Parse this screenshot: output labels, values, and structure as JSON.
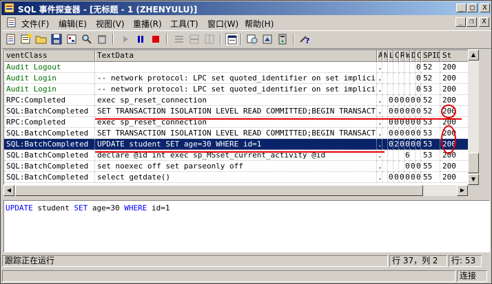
{
  "window": {
    "title": "SQL 事件探查器 - [无标题 - 1 (ZHENYULU)]",
    "buttons": {
      "minimize": "_",
      "maximize": "□",
      "close": "X"
    },
    "mdi_buttons": {
      "minimize": "_",
      "restore": "❐",
      "close": "X"
    }
  },
  "menu": [
    {
      "label": "文件(F)"
    },
    {
      "label": "编辑(E)"
    },
    {
      "label": "视图(V)"
    },
    {
      "label": "重播(R)"
    },
    {
      "label": "工具(T)"
    },
    {
      "label": "窗口(W)"
    },
    {
      "label": "帮助(H)"
    }
  ],
  "grid": {
    "columns": [
      "ventClass",
      "TextData",
      "A",
      "N",
      "L",
      "C",
      "R",
      "W",
      "D",
      "C",
      "SPID",
      "St"
    ],
    "rows": [
      {
        "cells": [
          "Audit Logout",
          "",
          "......",
          "",
          "",
          "",
          "",
          "",
          "",
          "0",
          "52",
          "200"
        ],
        "style": "green"
      },
      {
        "cells": [
          "Audit Login",
          "-- network protocol: LPC set quoted_identifier on set implicit_...",
          "......",
          "",
          "",
          "",
          "",
          "",
          "",
          "0",
          "52",
          "200"
        ],
        "style": "green"
      },
      {
        "cells": [
          "Audit Login",
          "-- network protocol: LPC set quoted_identifier on set implicit_...",
          "......",
          "",
          "",
          "",
          "",
          "",
          "",
          "0",
          "53",
          "200"
        ],
        "style": "green"
      },
      {
        "cells": [
          "RPC:Completed",
          "exec sp_reset_connection",
          "......",
          "",
          "0",
          "0",
          "0",
          "0",
          "0",
          "0",
          "52",
          "200"
        ],
        "style": ""
      },
      {
        "cells": [
          "SQL:BatchCompleted",
          "SET TRANSACTION ISOLATION LEVEL READ COMMITTED;BEGIN TRANSACTION",
          "......",
          "",
          "0",
          "0",
          "0",
          "0",
          "0",
          "0",
          "52",
          "200"
        ],
        "style": ""
      },
      {
        "cells": [
          "RPC:Completed",
          "exec sp_reset_connection",
          "......",
          "",
          "0",
          "0",
          "0",
          "0",
          "0",
          "0",
          "53",
          "200"
        ],
        "style": ""
      },
      {
        "cells": [
          "SQL:BatchCompleted",
          "SET TRANSACTION ISOLATION LEVEL READ COMMITTED;BEGIN TRANSACTION",
          "......",
          "",
          "0",
          "0",
          "0",
          "0",
          "0",
          "0",
          "53",
          "200"
        ],
        "style": ""
      },
      {
        "cells": [
          "SQL:BatchCompleted",
          "UPDATE student SET age=30 WHERE id=1",
          "......",
          "",
          "0",
          "2",
          "0",
          "0",
          "0",
          "0",
          "53",
          "200"
        ],
        "style": "sel"
      },
      {
        "cells": [
          "SQL:BatchCompleted",
          "declare @id int exec sp_MSset_current_activity @id",
          "......",
          "",
          "",
          "",
          "",
          "6",
          "",
          "",
          "53",
          "200"
        ],
        "style": ""
      },
      {
        "cells": [
          "SQL:BatchCompleted",
          "set noexec off set parseonly off",
          "......",
          "",
          "",
          "",
          "",
          "0",
          "0",
          "0",
          "55",
          "200"
        ],
        "style": ""
      },
      {
        "cells": [
          "SQL:BatchCompleted",
          "select getdate()",
          "......",
          "",
          "0",
          "0",
          "0",
          "0",
          "0",
          "0",
          "55",
          "200"
        ],
        "style": ""
      }
    ]
  },
  "detail": {
    "tokens": [
      {
        "t": "UPDATE",
        "kw": true
      },
      {
        "t": " student ",
        "kw": false
      },
      {
        "t": "SET",
        "kw": true
      },
      {
        "t": " age=30 ",
        "kw": false
      },
      {
        "t": "WHERE",
        "kw": true
      },
      {
        "t": " id=1",
        "kw": false
      }
    ]
  },
  "status": {
    "message": "跟踪正在运行",
    "position": "行 37，列 2",
    "rows": "行: 53",
    "connection": "连接"
  },
  "colors": {
    "title_start": "#0a246a",
    "title_end": "#a6caf0",
    "selection": "#0a246a",
    "annotation": "#e00000",
    "keyword": "#0000ff",
    "audit_text": "#007000"
  }
}
